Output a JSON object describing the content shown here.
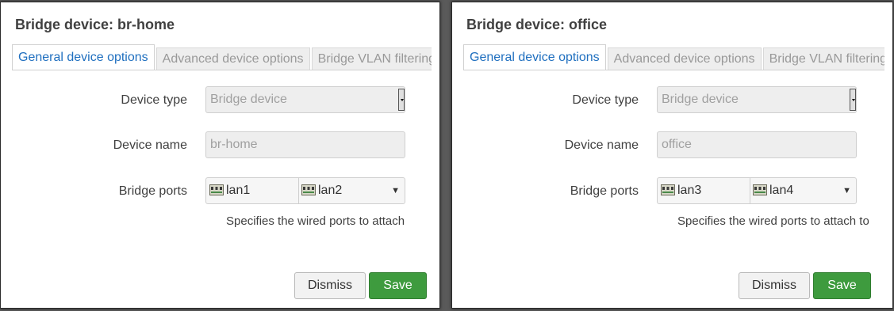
{
  "dialogs": [
    {
      "title": "Bridge device: br-home",
      "tabs": [
        "General device options",
        "Advanced device options",
        "Bridge VLAN filtering"
      ],
      "device_type_label": "Device type",
      "device_type_value": "Bridge device",
      "device_name_label": "Device name",
      "device_name_value": "br-home",
      "bridge_ports_label": "Bridge ports",
      "ports": [
        "lan1",
        "lan2"
      ],
      "help_text": "Specifies the wired ports to attach",
      "dismiss_label": "Dismiss",
      "save_label": "Save"
    },
    {
      "title": "Bridge device: office",
      "tabs": [
        "General device options",
        "Advanced device options",
        "Bridge VLAN filtering"
      ],
      "device_type_label": "Device type",
      "device_type_value": "Bridge device",
      "device_name_label": "Device name",
      "device_name_value": "office",
      "bridge_ports_label": "Bridge ports",
      "ports": [
        "lan3",
        "lan4"
      ],
      "help_text": "Specifies the wired ports to attach to",
      "dismiss_label": "Dismiss",
      "save_label": "Save"
    }
  ],
  "colors": {
    "active_tab": "#1f6fbf",
    "save_button": "#3e9b3e",
    "backdrop": "#5a5a5a"
  },
  "icons": {
    "port": "ethernet-port-icon",
    "dropdown": "chevron-down-icon"
  }
}
